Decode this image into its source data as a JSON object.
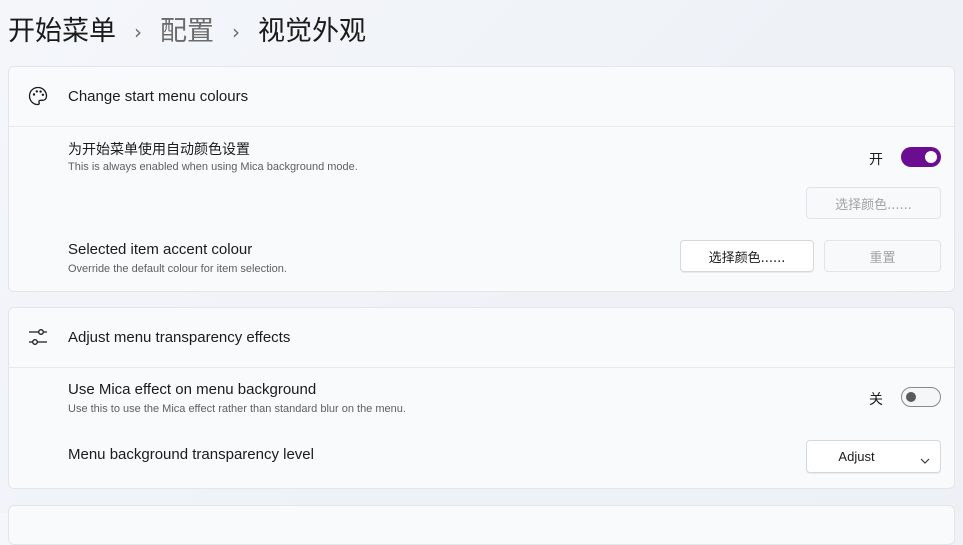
{
  "breadcrumb": {
    "items": [
      "开始菜单",
      "配置",
      "视觉外观"
    ],
    "separator": "›"
  },
  "colours_card": {
    "icon": "palette-icon",
    "title": "Change start menu colours",
    "auto_color": {
      "title": "为开始菜单使用自动颜色设置",
      "description": "This is always enabled when using Mica background mode.",
      "toggle_state_label": "开",
      "toggle_on": true,
      "pick_button": "选择颜色......"
    },
    "accent": {
      "title": "Selected item accent colour",
      "description": "Override the default colour for item selection.",
      "pick_button": "选择颜色......",
      "reset_button": "重置"
    }
  },
  "transparency_card": {
    "icon": "sliders-icon",
    "title": "Adjust menu transparency effects",
    "mica": {
      "title": "Use Mica effect on menu background",
      "description": "Use this to use the Mica effect rather than standard blur on the menu.",
      "toggle_state_label": "关",
      "toggle_on": false
    },
    "level": {
      "title": "Menu background transparency level",
      "selected": "Adjust"
    }
  },
  "colors": {
    "accent": "#6a0d91",
    "background": "#f1f4f8",
    "card": "#f9fafc"
  }
}
